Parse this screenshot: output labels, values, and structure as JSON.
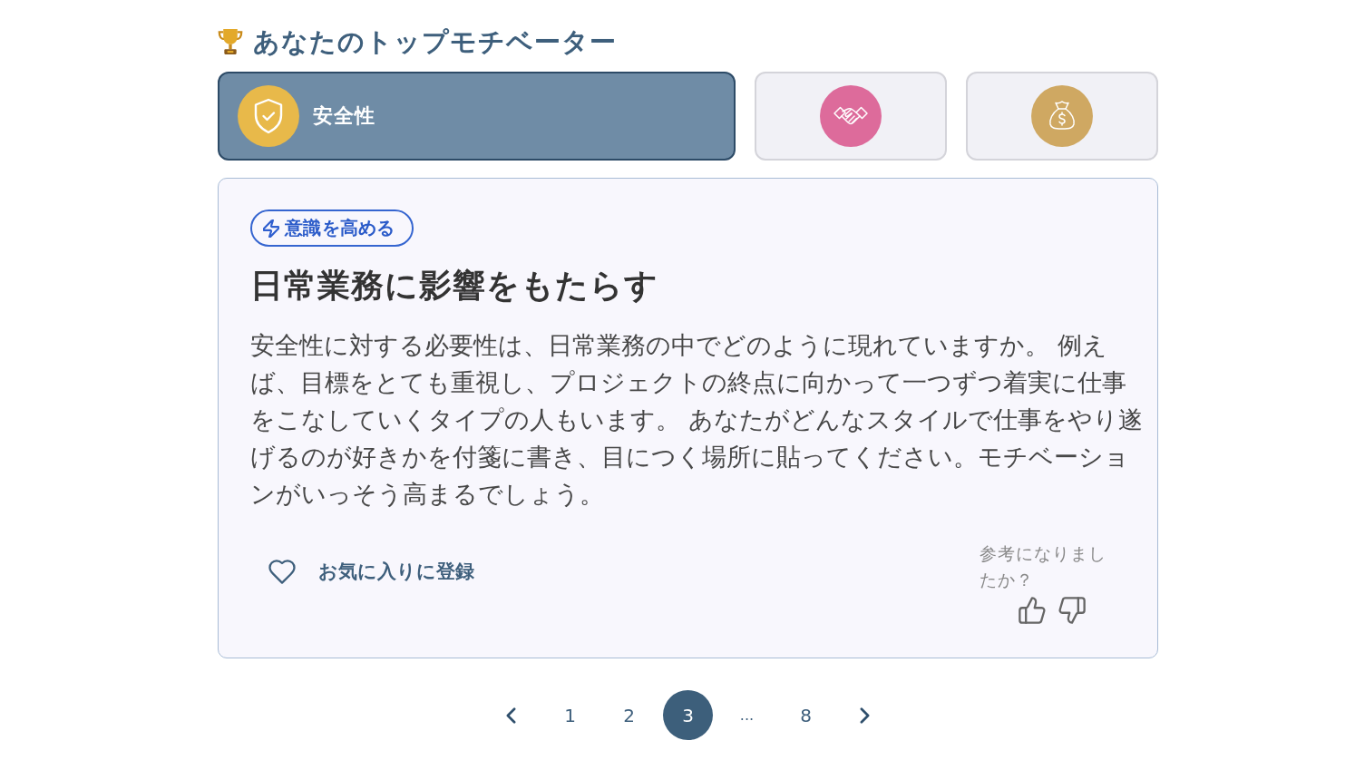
{
  "heading": {
    "text": "あなたのトップモチベーター"
  },
  "motivators": [
    {
      "label": "安全性",
      "selected": true,
      "color": "#e8b94a"
    },
    {
      "selected": false,
      "color": "#dd6b9b"
    },
    {
      "selected": false,
      "color": "#cfa862"
    }
  ],
  "detail": {
    "tag": "意識を高める",
    "title": "日常業務に影響をもたらす",
    "body": "安全性に対する必要性は、日常業務の中でどのように現れていますか。 例えば、目標をとても重視し、プロジェクトの終点に向かって一つずつ着実に仕事をこなしていくタイプの人もいます。 あなたがどんなスタイルで仕事をやり遂げるのが好きかを付箋に書き、目につく場所に貼ってください。モチベーションがいっそう高まるでしょう。",
    "favorite": {
      "label": "お気に入りに登録",
      "on": false
    },
    "feedback": {
      "question": "参考になりましたか？"
    }
  },
  "pagination": {
    "pages": [
      {
        "label": "1",
        "kind": "page",
        "selected": false
      },
      {
        "label": "2",
        "kind": "page",
        "selected": false
      },
      {
        "label": "3",
        "kind": "page",
        "selected": true
      },
      {
        "label": "...",
        "kind": "gap",
        "selected": false
      },
      {
        "label": "8",
        "kind": "page",
        "selected": false
      }
    ]
  }
}
